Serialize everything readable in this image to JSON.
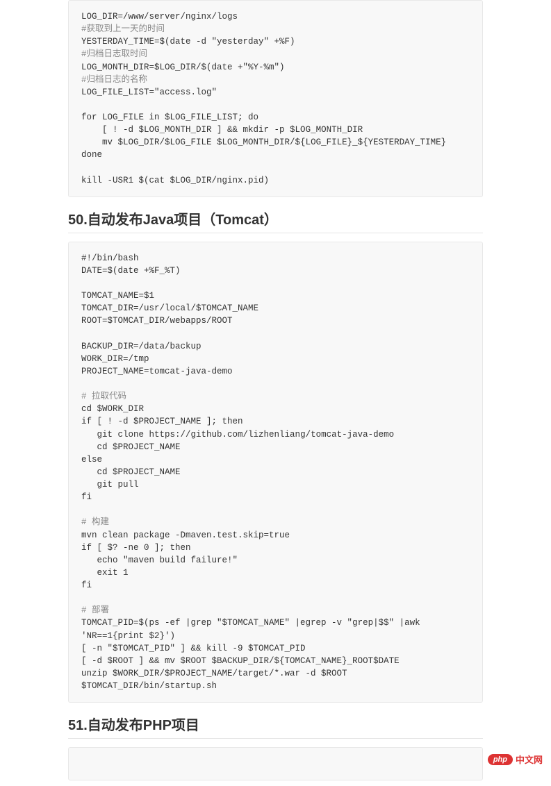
{
  "code_block_1": {
    "lines": [
      {
        "t": "LOG_DIR=/www/server/nginx/logs"
      },
      {
        "t": "#获取到上一天的时间",
        "c": true
      },
      {
        "t": "YESTERDAY_TIME=$(date -d \"yesterday\" +%F)"
      },
      {
        "t": "#归档日志取时间",
        "c": true
      },
      {
        "t": "LOG_MONTH_DIR=$LOG_DIR/$(date +\"%Y-%m\")"
      },
      {
        "t": "#归档日志的名称",
        "c": true
      },
      {
        "t": "LOG_FILE_LIST=\"access.log\""
      },
      {
        "t": ""
      },
      {
        "t": "for LOG_FILE in $LOG_FILE_LIST; do"
      },
      {
        "t": "    [ ! -d $LOG_MONTH_DIR ] && mkdir -p $LOG_MONTH_DIR"
      },
      {
        "t": "    mv $LOG_DIR/$LOG_FILE $LOG_MONTH_DIR/${LOG_FILE}_${YESTERDAY_TIME}"
      },
      {
        "t": "done"
      },
      {
        "t": ""
      },
      {
        "t": "kill -USR1 $(cat $LOG_DIR/nginx.pid)"
      }
    ]
  },
  "heading_50": "50.自动发布Java项目（Tomcat）",
  "code_block_2": {
    "lines": [
      {
        "t": "#!/bin/bash"
      },
      {
        "t": "DATE=$(date +%F_%T)"
      },
      {
        "t": ""
      },
      {
        "t": "TOMCAT_NAME=$1"
      },
      {
        "t": "TOMCAT_DIR=/usr/local/$TOMCAT_NAME"
      },
      {
        "t": "ROOT=$TOMCAT_DIR/webapps/ROOT"
      },
      {
        "t": ""
      },
      {
        "t": "BACKUP_DIR=/data/backup"
      },
      {
        "t": "WORK_DIR=/tmp"
      },
      {
        "t": "PROJECT_NAME=tomcat-java-demo"
      },
      {
        "t": ""
      },
      {
        "t": "# 拉取代码",
        "c": true
      },
      {
        "t": "cd $WORK_DIR"
      },
      {
        "t": "if [ ! -d $PROJECT_NAME ]; then"
      },
      {
        "t": "   git clone https://github.com/lizhenliang/tomcat-java-demo"
      },
      {
        "t": "   cd $PROJECT_NAME"
      },
      {
        "t": "else"
      },
      {
        "t": "   cd $PROJECT_NAME"
      },
      {
        "t": "   git pull"
      },
      {
        "t": "fi"
      },
      {
        "t": ""
      },
      {
        "t": "# 构建",
        "c": true
      },
      {
        "t": "mvn clean package -Dmaven.test.skip=true"
      },
      {
        "t": "if [ $? -ne 0 ]; then"
      },
      {
        "t": "   echo \"maven build failure!\""
      },
      {
        "t": "   exit 1"
      },
      {
        "t": "fi"
      },
      {
        "t": ""
      },
      {
        "t": "# 部署",
        "c": true
      },
      {
        "t": "TOMCAT_PID=$(ps -ef |grep \"$TOMCAT_NAME\" |egrep -v \"grep|$$\" |awk 'NR==1{print $2}')"
      },
      {
        "t": "[ -n \"$TOMCAT_PID\" ] && kill -9 $TOMCAT_PID"
      },
      {
        "t": "[ -d $ROOT ] && mv $ROOT $BACKUP_DIR/${TOMCAT_NAME}_ROOT$DATE"
      },
      {
        "t": "unzip $WORK_DIR/$PROJECT_NAME/target/*.war -d $ROOT"
      },
      {
        "t": "$TOMCAT_DIR/bin/startup.sh"
      }
    ]
  },
  "heading_51": "51.自动发布PHP项目",
  "watermark": {
    "badge": "php",
    "label": "中文网"
  }
}
